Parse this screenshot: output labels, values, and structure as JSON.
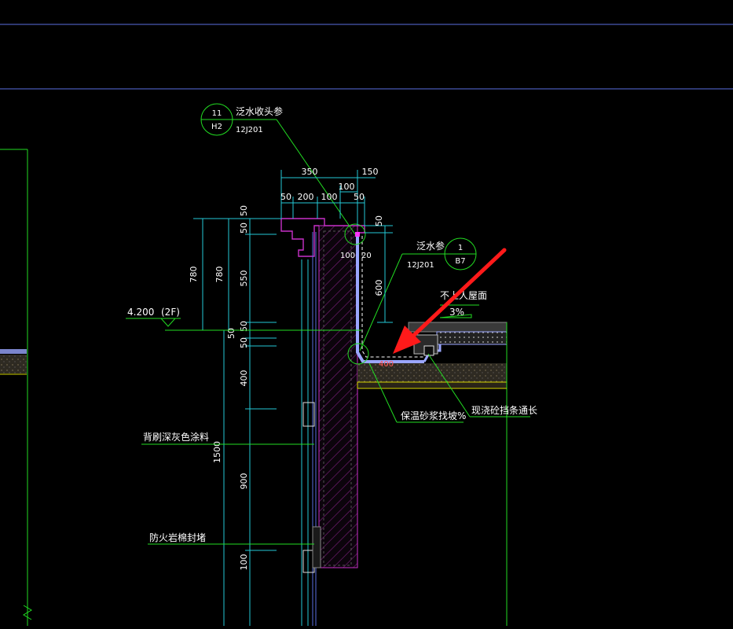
{
  "colors": {
    "background": "#000000",
    "frame_line": "#5a6ee0",
    "dim_line": "#23c9d6",
    "leader_green": "#22dd22",
    "slab_outline": "#d6d600",
    "hatch": "#c830c8",
    "membrane": "#9aa6ff",
    "concrete": "#3a3a3a",
    "arrow_red": "#ff1a1a",
    "text": "#ffffff"
  },
  "callouts": {
    "top_ref": {
      "number": "11",
      "sheet": "H2",
      "label": "泛水收头参",
      "atlas": "12J201"
    },
    "side_ref": {
      "number": "1",
      "sheet": "B7",
      "label": "泛水参",
      "atlas": "12J201"
    }
  },
  "dimensions": {
    "top_350": "350",
    "top_150": "150",
    "top_100": "100",
    "seg_50a": "50",
    "seg_200": "200",
    "seg_100": "100",
    "seg_50b": "50",
    "right_50": "50",
    "right_100": "100",
    "right_20": "20",
    "right_600": "600",
    "base_400": "400",
    "left_780a": "780",
    "left_780b": "780",
    "left_1500": "1500",
    "v_50a": "50",
    "v_50b": "50",
    "v_550": "550",
    "v_50c": "50",
    "v_50d": "50",
    "v_50e": "50",
    "v_400": "400",
    "v_900": "900",
    "v_100": "100"
  },
  "level": {
    "elevation": "4.200",
    "floor": "(2F)"
  },
  "labels": {
    "roof": "不上人屋面",
    "slope": "3%",
    "mortar": "保温砂浆找坡%",
    "strip": "现浇砼挡条通长",
    "paint": "背刷深灰色涂料",
    "firestop": "防火岩棉封堵"
  }
}
